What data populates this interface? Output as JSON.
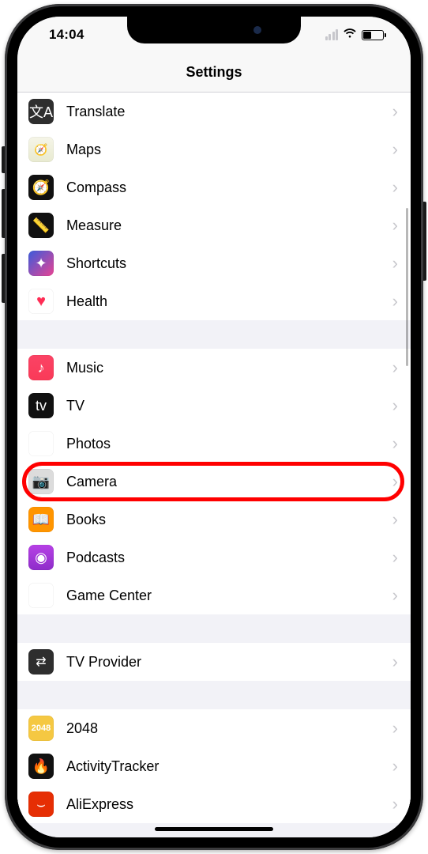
{
  "status": {
    "time": "14:04"
  },
  "nav": {
    "title": "Settings"
  },
  "groups": [
    {
      "items": [
        {
          "id": "translate",
          "label": "Translate",
          "icon": "ic-translate",
          "glyph": "文A"
        },
        {
          "id": "maps",
          "label": "Maps",
          "icon": "ic-maps",
          "glyph": "🧭"
        },
        {
          "id": "compass",
          "label": "Compass",
          "icon": "ic-compass",
          "glyph": "🧭"
        },
        {
          "id": "measure",
          "label": "Measure",
          "icon": "ic-measure",
          "glyph": "📏"
        },
        {
          "id": "shortcuts",
          "label": "Shortcuts",
          "icon": "ic-shortcuts",
          "glyph": "✦"
        },
        {
          "id": "health",
          "label": "Health",
          "icon": "ic-health",
          "glyph": "♥"
        }
      ]
    },
    {
      "items": [
        {
          "id": "music",
          "label": "Music",
          "icon": "ic-music",
          "glyph": "♪"
        },
        {
          "id": "tv",
          "label": "TV",
          "icon": "ic-tv",
          "glyph": "tv"
        },
        {
          "id": "photos",
          "label": "Photos",
          "icon": "ic-photos",
          "glyph": "✿"
        },
        {
          "id": "camera",
          "label": "Camera",
          "icon": "ic-camera",
          "glyph": "📷",
          "highlighted": true
        },
        {
          "id": "books",
          "label": "Books",
          "icon": "ic-books",
          "glyph": "📖"
        },
        {
          "id": "podcasts",
          "label": "Podcasts",
          "icon": "ic-podcasts",
          "glyph": "◉"
        },
        {
          "id": "gamecenter",
          "label": "Game Center",
          "icon": "ic-gamecenter",
          "glyph": "✦"
        }
      ]
    },
    {
      "items": [
        {
          "id": "tvprovider",
          "label": "TV Provider",
          "icon": "ic-tvprovider",
          "glyph": "⇄"
        }
      ]
    },
    {
      "items": [
        {
          "id": "2048",
          "label": "2048",
          "icon": "ic-2048",
          "glyph": "2048"
        },
        {
          "id": "activitytracker",
          "label": "ActivityTracker",
          "icon": "ic-activitytracker",
          "glyph": "🔥"
        },
        {
          "id": "aliexpress",
          "label": "AliExpress",
          "icon": "ic-aliexpress",
          "glyph": "⌣"
        }
      ]
    }
  ]
}
